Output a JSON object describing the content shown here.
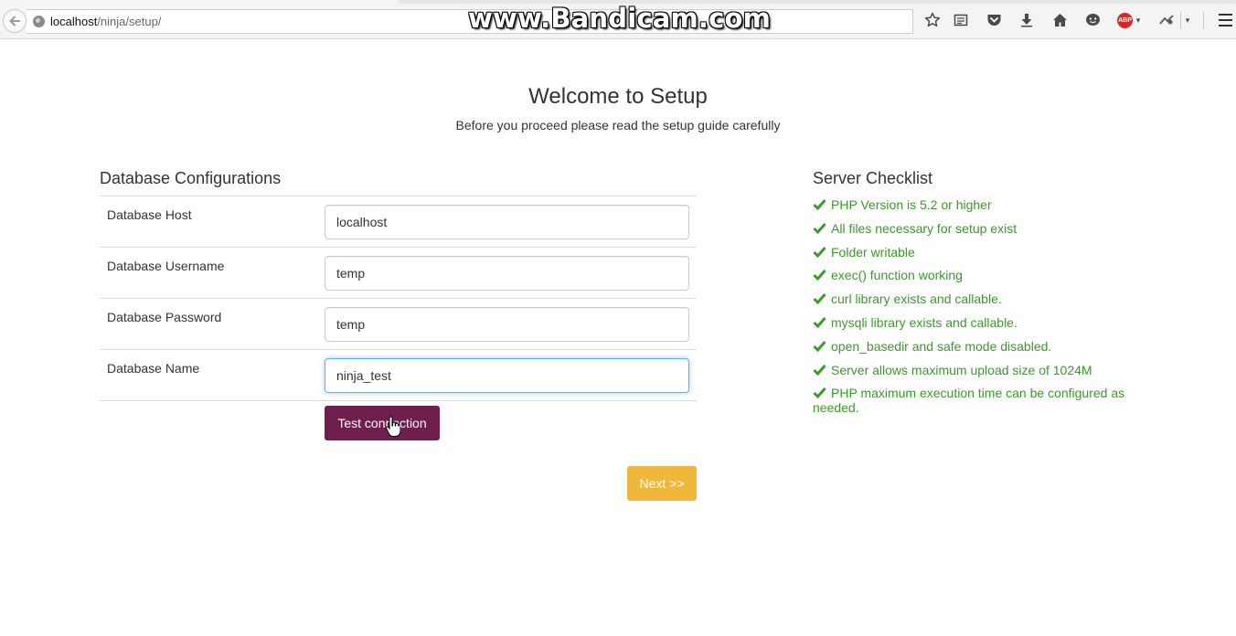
{
  "browser": {
    "url_host": "localhost",
    "url_path": "/ninja/setup/",
    "watermark": "www.Bandicam.com"
  },
  "icons": {
    "back": "back-arrow-icon",
    "site": "globe-icon",
    "toolbar": [
      "star-icon",
      "reading-list-icon",
      "pocket-icon",
      "download-icon",
      "home-icon",
      "chat-icon",
      "adblock-icon",
      "extension-icon",
      "chevron-down-icon",
      "hamburger-menu-icon"
    ]
  },
  "header": {
    "title": "Welcome to Setup",
    "subtitle": "Before you proceed please read the setup guide carefully"
  },
  "database": {
    "heading": "Database Configurations",
    "fields": [
      {
        "label": "Database Host",
        "value": "localhost"
      },
      {
        "label": "Database Username",
        "value": "temp"
      },
      {
        "label": "Database Password",
        "value": "temp"
      },
      {
        "label": "Database Name",
        "value": "ninja_test"
      }
    ],
    "test_button": "Test connection",
    "next_button": "Next >>"
  },
  "checklist": {
    "heading": "Server Checklist",
    "items": [
      "PHP Version is 5.2 or higher",
      "All files necessary for setup exist",
      "Folder writable",
      "exec() function working",
      "curl library exists and callable.",
      "mysqli library exists and callable.",
      "open_basedir and safe mode disabled.",
      "Server allows maximum upload size of 1024M",
      "PHP maximum execution time can be configured as needed."
    ]
  },
  "colors": {
    "check_green": "#3a9a2a",
    "test_button_bg": "#6f1f4d",
    "next_button_bg": "#f0b83a",
    "focus_border": "#66afe9"
  }
}
